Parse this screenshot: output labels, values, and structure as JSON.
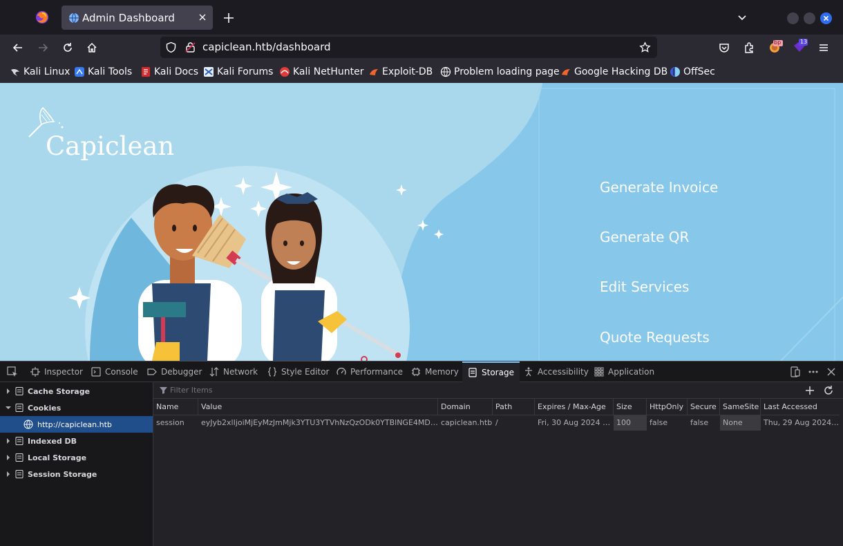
{
  "browser": {
    "tab": {
      "title": "Admin Dashboard"
    },
    "url": "capiclean.htb/dashboard",
    "extensions": {
      "badge_bp": "bp",
      "badge_count": "13"
    },
    "bookmarks": [
      {
        "label": "Kali Linux",
        "icon": "kali-dragon-icon"
      },
      {
        "label": "Kali Tools",
        "icon": "kali-tools-icon"
      },
      {
        "label": "Kali Docs",
        "icon": "kali-docs-icon"
      },
      {
        "label": "Kali Forums",
        "icon": "kali-forums-icon"
      },
      {
        "label": "Kali NetHunter",
        "icon": "nethunter-icon"
      },
      {
        "label": "Exploit-DB",
        "icon": "exploit-db-icon"
      },
      {
        "label": "Problem loading page",
        "icon": "globe-icon"
      },
      {
        "label": "Google Hacking DB",
        "icon": "ghdb-icon"
      },
      {
        "label": "OffSec",
        "icon": "offsec-icon"
      }
    ]
  },
  "page": {
    "brand": "Capiclean",
    "menu": [
      "Generate Invoice",
      "Generate QR",
      "Edit Services",
      "Quote Requests"
    ],
    "colors": {
      "background": "#a9d8ec",
      "panel": "#86c7ea",
      "dark_accent": "#2d5f86"
    }
  },
  "devtools": {
    "tabs": [
      "Inspector",
      "Console",
      "Debugger",
      "Network",
      "Style Editor",
      "Performance",
      "Memory",
      "Storage",
      "Accessibility",
      "Application"
    ],
    "active_tab": "Storage",
    "sidebar": {
      "items": [
        "Cache Storage",
        "Cookies",
        "http://capiclean.htb",
        "Indexed DB",
        "Local Storage",
        "Session Storage"
      ]
    },
    "filter_placeholder": "Filter Items",
    "table": {
      "columns": [
        "Name",
        "Value",
        "Domain",
        "Path",
        "Expires / Max-Age",
        "Size",
        "HttpOnly",
        "Secure",
        "SameSite",
        "Last Accessed"
      ],
      "rows": [
        [
          "session",
          "eyJyb2xlIjoiMjEyMzJmMjk3YTU3YTVhNzQzODk0YTBlNGE4MDFm…",
          "capiclean.htb",
          "/",
          "Fri, 30 Aug 2024 0…",
          "100",
          "false",
          "false",
          "None",
          "Thu, 29 Aug 2024 0…"
        ]
      ]
    }
  }
}
